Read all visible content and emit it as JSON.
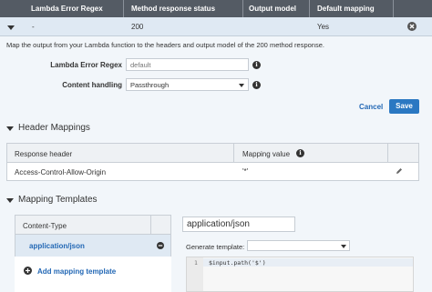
{
  "table": {
    "headers": [
      "Lambda Error Regex",
      "Method response status",
      "Output model",
      "Default mapping"
    ],
    "row": {
      "regex": "-",
      "status": "200",
      "output_model": "",
      "default_mapping": "Yes"
    }
  },
  "panel": {
    "description": "Map the output from your Lambda function to the headers and output model of the 200 method response.",
    "regex_label": "Lambda Error Regex",
    "regex_placeholder": "default",
    "content_handling_label": "Content handling",
    "content_handling_value": "Passthrough",
    "cancel_label": "Cancel",
    "save_label": "Save"
  },
  "header_mappings": {
    "title": "Header Mappings",
    "col_header": "Response header",
    "col_value": "Mapping value",
    "row": {
      "header": "Access-Control-Allow-Origin",
      "value": "'*'"
    }
  },
  "mapping_templates": {
    "title": "Mapping Templates",
    "content_type_header": "Content-Type",
    "selected_type": "application/json",
    "add_label": "Add mapping template",
    "type_input_value": "application/json",
    "generate_label": "Generate template:",
    "generate_value": "",
    "code_line_number": "1",
    "code_line": "$input.path('$')"
  },
  "icons": [
    "chevron-down-icon",
    "close-circle-icon",
    "info-icon",
    "select-arrow-icon",
    "pencil-icon",
    "minus-circle-icon",
    "plus-circle-icon"
  ]
}
